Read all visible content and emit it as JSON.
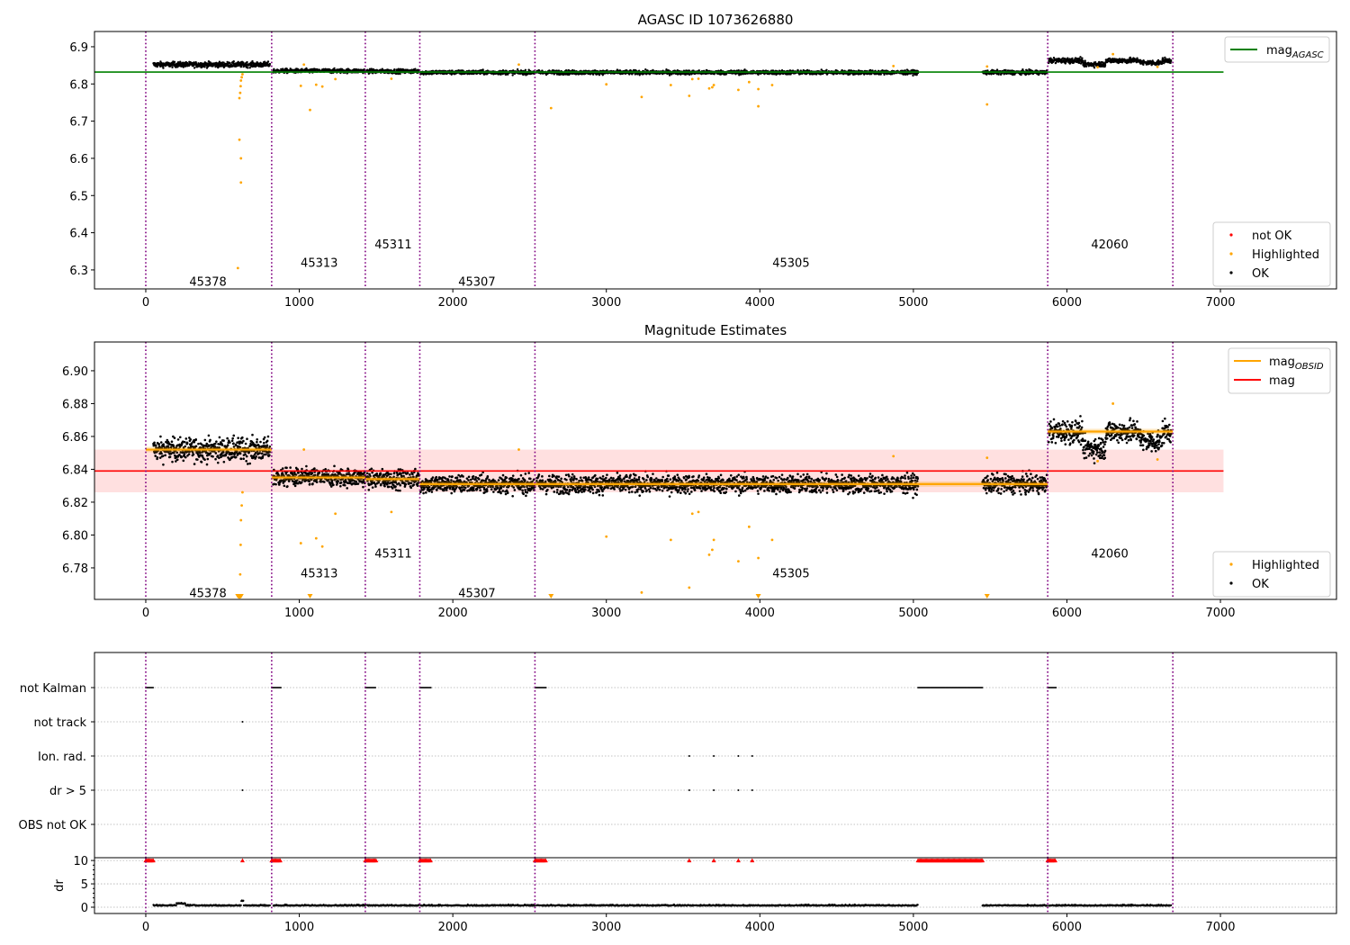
{
  "chart_data": [
    {
      "type": "scatter",
      "title": "AGASC ID 1073626880",
      "xlim": [
        -334,
        7756
      ],
      "ylim": [
        6.249,
        6.941
      ],
      "xticks": [
        0,
        1000,
        2000,
        3000,
        4000,
        5000,
        6000,
        7000
      ],
      "yticks": [
        6.3,
        6.4,
        6.5,
        6.6,
        6.7,
        6.8,
        6.9
      ],
      "obsid_boundaries": [
        0,
        820,
        1430,
        1785,
        2535,
        5875,
        6690
      ],
      "obsid_labels": [
        {
          "text": "45378",
          "x": 405,
          "y": 6.27
        },
        {
          "text": "45313",
          "x": 1130,
          "y": 6.32
        },
        {
          "text": "45311",
          "x": 1612,
          "y": 6.37
        },
        {
          "text": "45307",
          "x": 2157,
          "y": 6.27
        },
        {
          "text": "45305",
          "x": 4203,
          "y": 6.32
        },
        {
          "text": "42060",
          "x": 6279,
          "y": 6.37
        }
      ],
      "mag_agasc": 6.832,
      "legend_top": {
        "label": "mag",
        "sub": "AGASC",
        "color": "#008000"
      },
      "legend_bottom": [
        {
          "label": "not OK",
          "color": "#ff0000"
        },
        {
          "label": "Highlighted",
          "color": "#ffa500"
        },
        {
          "label": "OK",
          "color": "#000000"
        }
      ]
    },
    {
      "type": "scatter",
      "title": "Magnitude Estimates",
      "xlim": [
        -334,
        7756
      ],
      "ylim": [
        6.7608,
        6.9175
      ],
      "xticks": [
        0,
        1000,
        2000,
        3000,
        4000,
        5000,
        6000,
        7000
      ],
      "yticks": [
        6.78,
        6.8,
        6.82,
        6.84,
        6.86,
        6.88,
        6.9
      ],
      "obsid_labels": [
        {
          "text": "45378",
          "x": 405,
          "y": 6.765
        },
        {
          "text": "45313",
          "x": 1130,
          "y": 6.777
        },
        {
          "text": "45311",
          "x": 1612,
          "y": 6.789
        },
        {
          "text": "45307",
          "x": 2157,
          "y": 6.765
        },
        {
          "text": "45305",
          "x": 4203,
          "y": 6.777
        },
        {
          "text": "42060",
          "x": 6279,
          "y": 6.789
        }
      ],
      "mag": 6.839,
      "mag_band": [
        6.826,
        6.852
      ],
      "mag_obsid": [
        {
          "x0": 0,
          "x1": 820,
          "mag": 6.852
        },
        {
          "x0": 820,
          "x1": 1430,
          "mag": 6.835
        },
        {
          "x0": 1430,
          "x1": 1785,
          "mag": 6.834
        },
        {
          "x0": 1785,
          "x1": 2535,
          "mag": 6.831
        },
        {
          "x0": 2535,
          "x1": 5875,
          "mag": 6.831
        },
        {
          "x0": 5875,
          "x1": 6690,
          "mag": 6.863
        }
      ],
      "legend_top": [
        {
          "label": "mag",
          "sub": "OBSID",
          "color": "#ffa500"
        },
        {
          "label": "mag",
          "sub": "",
          "color": "#ff0000"
        }
      ],
      "legend_bottom": [
        {
          "label": "Highlighted",
          "color": "#ffa500"
        },
        {
          "label": "OK",
          "color": "#000000"
        }
      ]
    },
    {
      "type": "scatter",
      "title": "flags",
      "categories": [
        "not Kalman",
        "not track",
        "Ion. rad.",
        "dr > 5",
        "OBS not OK"
      ],
      "not_kalman_ranges": [
        [
          0,
          50
        ],
        [
          820,
          880
        ],
        [
          1430,
          1500
        ],
        [
          1785,
          1860
        ],
        [
          2535,
          2610
        ],
        [
          5030,
          5450
        ],
        [
          5875,
          5930
        ]
      ],
      "not_track": [
        630
      ],
      "ion_rad": [
        3540,
        3700,
        3860,
        3950
      ],
      "dr_gt_5": [
        630,
        3540,
        3700,
        3860,
        3950
      ],
      "obs_not_ok": []
    },
    {
      "type": "scatter",
      "ylabel": "dr",
      "ylim": [
        -1.35,
        10.6
      ],
      "yticks": [
        0,
        5,
        10
      ],
      "clip_value": 10,
      "typical_dr": 0.3
    }
  ],
  "segments": [
    {
      "obsid": "45378",
      "t0": 50,
      "t1": 810,
      "mag": 6.852,
      "sigma": 0.005
    },
    {
      "obsid": "45313",
      "t0": 830,
      "t1": 1430,
      "mag": 6.835,
      "sigma": 0.004
    },
    {
      "obsid": "45311",
      "t0": 1440,
      "t1": 1780,
      "mag": 6.834,
      "sigma": 0.004
    },
    {
      "obsid": "45307",
      "t0": 1790,
      "t1": 2535,
      "mag": 6.831,
      "sigma": 0.004
    },
    {
      "obsid": "45305",
      "t0": 2545,
      "t1": 5030,
      "mag": 6.831,
      "sigma": 0.004
    },
    {
      "obsid": "45305",
      "t0": 5450,
      "t1": 5870,
      "mag": 6.831,
      "sigma": 0.004
    },
    {
      "obsid": "42060",
      "t0": 5880,
      "t1": 6680,
      "mag": 6.863,
      "sigma": 0.005
    }
  ],
  "highlighted": [
    [
      600,
      6.305
    ],
    [
      610,
      6.65
    ],
    [
      620,
      6.6
    ],
    [
      620,
      6.535
    ],
    [
      610,
      6.762
    ],
    [
      615,
      6.776
    ],
    [
      618,
      6.794
    ],
    [
      620,
      6.809
    ],
    [
      625,
      6.818
    ],
    [
      630,
      6.826
    ],
    [
      1010,
      6.795
    ],
    [
      1070,
      6.73
    ],
    [
      1110,
      6.798
    ],
    [
      1150,
      6.793
    ],
    [
      1235,
      6.813
    ],
    [
      1600,
      6.814
    ],
    [
      1030,
      6.852
    ],
    [
      2430,
      6.852
    ],
    [
      2640,
      6.735
    ],
    [
      3000,
      6.799
    ],
    [
      3230,
      6.765
    ],
    [
      3420,
      6.797
    ],
    [
      3540,
      6.768
    ],
    [
      3560,
      6.813
    ],
    [
      3600,
      6.814
    ],
    [
      3670,
      6.788
    ],
    [
      3690,
      6.791
    ],
    [
      3700,
      6.797
    ],
    [
      3860,
      6.784
    ],
    [
      3930,
      6.805
    ],
    [
      3990,
      6.74
    ],
    [
      3990,
      6.786
    ],
    [
      4080,
      6.797
    ],
    [
      4870,
      6.848
    ],
    [
      5480,
      6.745
    ],
    [
      5480,
      6.847
    ],
    [
      6200,
      6.845
    ],
    [
      6300,
      6.88
    ],
    [
      6590,
      6.846
    ]
  ]
}
